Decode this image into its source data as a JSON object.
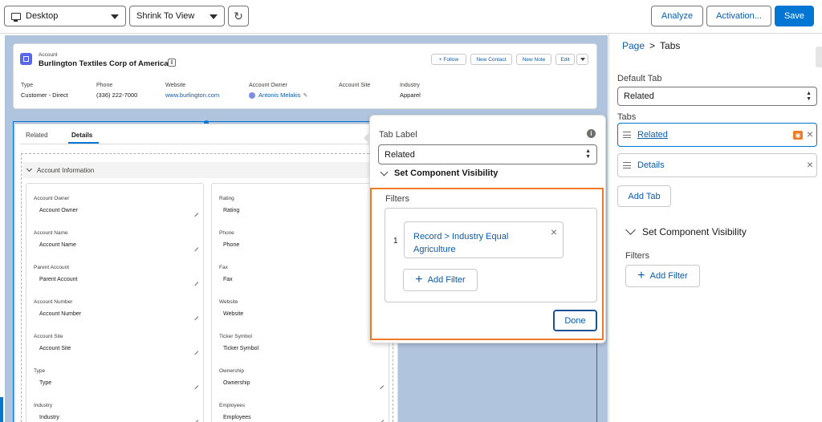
{
  "toolbar": {
    "device": "Desktop",
    "zoom": "Shrink To View",
    "analyze": "Analyze",
    "activation": "Activation...",
    "save": "Save"
  },
  "record": {
    "object": "Account",
    "name": "Burlington Textiles Corp of America",
    "actions": [
      "+ Follow",
      "New Contact",
      "New Note",
      "Edit"
    ],
    "highlights": [
      {
        "label": "Type",
        "value": "Customer - Direct"
      },
      {
        "label": "Phone",
        "value": "(336) 222-7000"
      },
      {
        "label": "Website",
        "value": "www.burlington.com"
      },
      {
        "label": "Account Owner",
        "value": "Antonis Melakis"
      },
      {
        "label": "Account Site",
        "value": ""
      },
      {
        "label": "Industry",
        "value": "Apparel"
      }
    ]
  },
  "detail_tabs": [
    "Related",
    "Details"
  ],
  "section_title": "Account Information",
  "left_fields": [
    {
      "label": "Account Owner",
      "value": "Account Owner"
    },
    {
      "label": "Account Name",
      "value": "Account Name"
    },
    {
      "label": "Parent Account",
      "value": "Parent Account"
    },
    {
      "label": "Account Number",
      "value": "Account Number"
    },
    {
      "label": "Account Site",
      "value": "Account Site"
    },
    {
      "label": "Type",
      "value": "Type"
    },
    {
      "label": "Industry",
      "value": "Industry"
    }
  ],
  "right_fields": [
    {
      "label": "Rating",
      "value": "Rating"
    },
    {
      "label": "Phone",
      "value": "Phone"
    },
    {
      "label": "Fax",
      "value": "Fax"
    },
    {
      "label": "Website",
      "value": "Website"
    },
    {
      "label": "Ticker Symbol",
      "value": "Ticker Symbol"
    },
    {
      "label": "Ownership",
      "value": "Ownership"
    },
    {
      "label": "Employees",
      "value": "Employees"
    }
  ],
  "popover": {
    "tab_label_title": "Tab Label",
    "tab_label_value": "Related",
    "visibility_title": "Set Component Visibility",
    "filters_title": "Filters",
    "filter_number": "1",
    "filter_text": "Record > Industry Equal Agriculture",
    "add_filter": "Add Filter",
    "done": "Done"
  },
  "panel": {
    "breadcrumb_page": "Page",
    "breadcrumb_sep": ">",
    "breadcrumb_current": "Tabs",
    "default_tab_label": "Default Tab",
    "default_tab_value": "Related",
    "tabs_label": "Tabs",
    "tabs": [
      "Related",
      "Details"
    ],
    "add_tab": "Add Tab",
    "visibility_title": "Set Component Visibility",
    "filters_label": "Filters",
    "add_filter": "Add Filter"
  },
  "colors": {
    "brand": "#0176d3",
    "highlight": "#f07b27",
    "canvas": "#b0c4de"
  }
}
